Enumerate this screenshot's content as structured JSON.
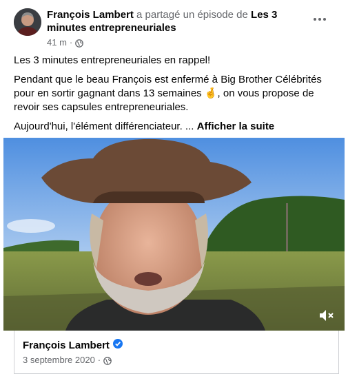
{
  "post": {
    "author": "François Lambert",
    "action": "a partagé un épisode de",
    "page_name": "Les 3 minutes entrepreneuriales",
    "time": "41 m",
    "separator": "·",
    "audience_icon": "globe-icon",
    "more_icon": "more-options-icon"
  },
  "text": {
    "line1": "Les 3 minutes entrepreneuriales en rappel!",
    "line2_before_emoji": "Pendant que le beau François est enfermé à Big Brother Célébrités pour en sortir gagnant dans 13 semaines ",
    "emoji": "🤞",
    "line2_after_emoji": ", on vous propose de revoir ses capsules entrepreneuriales.",
    "line3": "Aujourd'hui, l'élément différenciateur. ...",
    "see_more": "Afficher la suite"
  },
  "video": {
    "mute_icon": "volume-muted-icon"
  },
  "embed": {
    "name": "François Lambert",
    "verified_icon": "verified-badge-icon",
    "date": "3 septembre 2020",
    "separator": "·",
    "audience_icon": "globe-icon"
  },
  "colors": {
    "primary_text": "#050505",
    "secondary_text": "#65676b",
    "verified": "#1877f2",
    "divider": "#ced0d4"
  }
}
